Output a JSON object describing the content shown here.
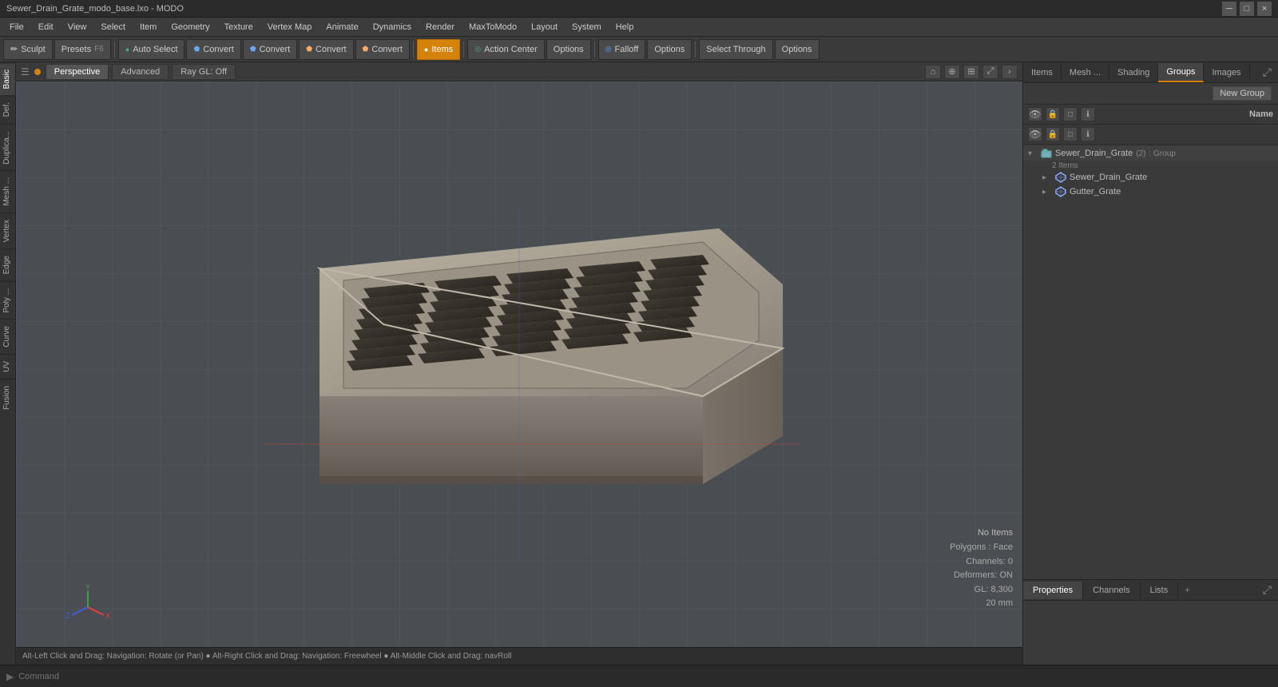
{
  "titlebar": {
    "title": "Sewer_Drain_Grate_modo_base.lxo - MODO",
    "controls": [
      "─",
      "□",
      "×"
    ]
  },
  "menubar": {
    "items": [
      "File",
      "Edit",
      "View",
      "Select",
      "Item",
      "Geometry",
      "Texture",
      "Vertex Map",
      "Animate",
      "Dynamics",
      "Render",
      "MaxToModo",
      "Layout",
      "System",
      "Help"
    ]
  },
  "toolbar": {
    "sculpt_label": "Sculpt",
    "presets_label": "Presets",
    "presets_shortcut": "F6",
    "auto_select_label": "Auto Select",
    "convert1_label": "Convert",
    "convert2_label": "Convert",
    "convert3_label": "Convert",
    "convert4_label": "Convert",
    "items_label": "Items",
    "action_center_label": "Action Center",
    "options1_label": "Options",
    "falloff_label": "Falloff",
    "options2_label": "Options",
    "select_through_label": "Select Through",
    "options3_label": "Options"
  },
  "viewport": {
    "tabs": [
      "Perspective",
      "Advanced"
    ],
    "ray_gl": "Ray GL: Off",
    "status": {
      "no_items": "No Items",
      "polygons": "Polygons : Face",
      "channels": "Channels: 0",
      "deformers": "Deformers: ON",
      "gl": "GL: 8,300",
      "unit": "20 mm"
    }
  },
  "left_sidebar": {
    "tabs": [
      "Basic",
      "Def.",
      "Duplica...",
      "Mesh ...",
      "Vertex",
      "Edge",
      "Poly ...",
      "Curve",
      "UV",
      "Fusion"
    ]
  },
  "right_panel": {
    "top_tabs": [
      "Items",
      "Mesh ...",
      "Shading",
      "Groups",
      "Images"
    ],
    "new_group_btn": "New Group",
    "col_header": "Name",
    "group": {
      "name": "Sewer_Drain_Grate",
      "count": "2",
      "type": "Group",
      "count_label": "2 Items",
      "items": [
        "Sewer_Drain_Grate",
        "Gutter_Grate"
      ]
    },
    "bottom_tabs": [
      "Properties",
      "Channels",
      "Lists"
    ],
    "add_btn": "+"
  },
  "statusbar": {
    "text": "Alt-Left Click and Drag: Navigation: Rotate (or Pan)  ●  Alt-Right Click and Drag: Navigation: Freewheel  ●  Alt-Middle Click and Drag: navRoll"
  },
  "commandbar": {
    "prompt": "▶",
    "placeholder": "Command"
  }
}
